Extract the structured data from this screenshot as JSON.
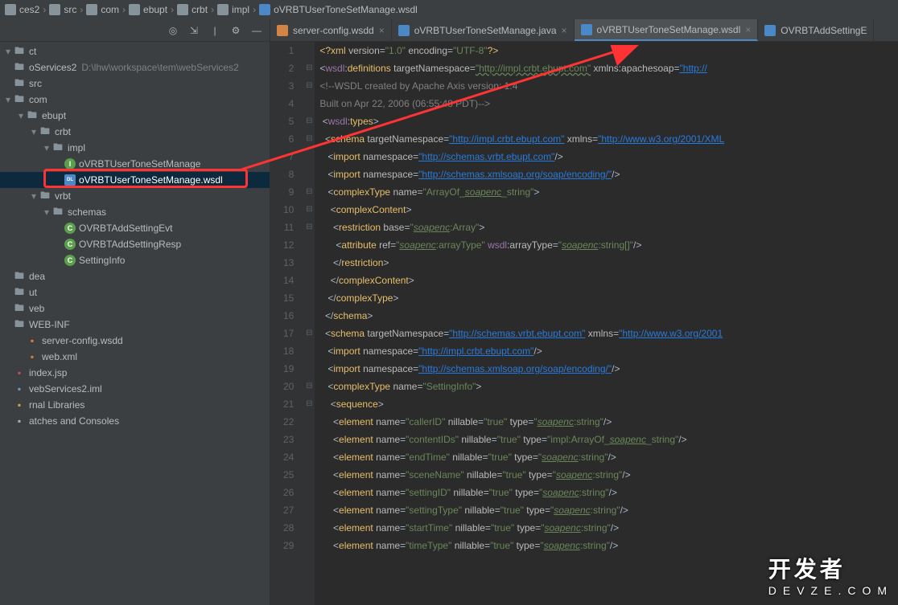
{
  "breadcrumb": [
    "ces2",
    "src",
    "com",
    "ebupt",
    "crbt",
    "impl",
    "oVRBTUserToneSetManage.wsdl"
  ],
  "project": {
    "name": "webServices2",
    "path": "D:\\lhw\\workspace\\tem\\webServices2"
  },
  "tree": [
    {
      "indent": 0,
      "arrow": "▾",
      "icon": "folder",
      "label": "ct"
    },
    {
      "indent": 0,
      "arrow": "",
      "icon": "folder",
      "label": "oServices2",
      "path": "D:\\lhw\\workspace\\tem\\webServices2"
    },
    {
      "indent": 0,
      "arrow": "",
      "icon": "folder",
      "label": "src"
    },
    {
      "indent": 0,
      "arrow": "▾",
      "icon": "folder",
      "label": "com"
    },
    {
      "indent": 1,
      "arrow": "▾",
      "icon": "folder",
      "label": "ebupt"
    },
    {
      "indent": 2,
      "arrow": "▾",
      "icon": "folder",
      "label": "crbt"
    },
    {
      "indent": 3,
      "arrow": "▾",
      "icon": "folder",
      "label": "impl"
    },
    {
      "indent": 4,
      "arrow": "",
      "icon": "interface-i",
      "iconText": "I",
      "label": "oVRBTUserToneSetManage"
    },
    {
      "indent": 4,
      "arrow": "",
      "icon": "wsdl",
      "iconText": "DL",
      "label": "oVRBTUserToneSetManage.wsdl",
      "selected": true,
      "boxed": true
    },
    {
      "indent": 2,
      "arrow": "▾",
      "icon": "folder",
      "label": "vrbt"
    },
    {
      "indent": 3,
      "arrow": "▾",
      "icon": "folder",
      "label": "schemas"
    },
    {
      "indent": 4,
      "arrow": "",
      "icon": "class-c",
      "iconText": "C",
      "label": "OVRBTAddSettingEvt"
    },
    {
      "indent": 4,
      "arrow": "",
      "icon": "class-c",
      "iconText": "C",
      "label": "OVRBTAddSettingResp"
    },
    {
      "indent": 4,
      "arrow": "",
      "icon": "class-c",
      "iconText": "C",
      "label": "SettingInfo"
    },
    {
      "indent": 0,
      "arrow": "",
      "icon": "folder",
      "label": "dea"
    },
    {
      "indent": 0,
      "arrow": "",
      "icon": "folder",
      "label": "ut"
    },
    {
      "indent": 0,
      "arrow": "",
      "icon": "folder",
      "label": "veb"
    },
    {
      "indent": 0,
      "arrow": "",
      "icon": "folder",
      "label": "WEB-INF"
    },
    {
      "indent": 1,
      "arrow": "",
      "icon": "xml",
      "label": "server-config.wsdd"
    },
    {
      "indent": 1,
      "arrow": "",
      "icon": "xml",
      "label": "web.xml"
    },
    {
      "indent": 0,
      "arrow": "",
      "icon": "jsp",
      "label": "index.jsp"
    },
    {
      "indent": 0,
      "arrow": "",
      "icon": "iml",
      "label": "vebServices2.iml"
    },
    {
      "indent": 0,
      "arrow": "",
      "icon": "lib",
      "label": "rnal Libraries"
    },
    {
      "indent": 0,
      "arrow": "",
      "icon": "file",
      "label": "atches and Consoles"
    }
  ],
  "tabs": [
    {
      "icon": "wsdd",
      "label": "server-config.wsdd",
      "close": true
    },
    {
      "icon": "java",
      "label": "oVRBTUserToneSetManage.java",
      "close": true
    },
    {
      "icon": "wsdl",
      "label": "oVRBTUserToneSetManage.wsdl",
      "close": true,
      "active": true
    },
    {
      "icon": "java",
      "label": "OVRBTAddSettingE"
    }
  ],
  "code": {
    "start": 1,
    "lines": [
      {
        "html": "<span class='pi'>&lt;?</span><span class='tag'>xml</span> <span class='attr'>version</span>=<span class='str'>\"1.0\"</span> <span class='attr'>encoding</span>=<span class='str'>\"UTF-8\"</span><span class='pi'>?&gt;</span>"
      },
      {
        "html": "<span class='punct'>&lt;</span><span class='ns'>wsdl</span>:<span class='tag'>definitions</span> <span class='attr'>targetNamespace</span>=<span class='str-u'>\"http://impl.crbt.ebupt.com\"</span> <span class='attr'>xmlns:apachesoap</span>=<span class='link'>\"http://</span>"
      },
      {
        "html": "<span class='cmt'>&lt;!--WSDL created by Apache Axis version: 1.4</span>"
      },
      {
        "html": "<span class='cmt'>Built on Apr 22, 2006 (06:55:48 PDT)--&gt;</span>"
      },
      {
        "html": " <span class='punct'>&lt;</span><span class='ns'>wsdl</span>:<span class='tag'>types</span><span class='punct'>&gt;</span>"
      },
      {
        "html": "  <span class='punct'>&lt;</span><span class='tag'>schema</span> <span class='attr'>targetNamespace</span>=<span class='link'>\"http://impl.crbt.ebupt.com\"</span> <span class='attr'>xmlns</span>=<span class='link'>\"http://www.w3.org/2001/XML</span>"
      },
      {
        "html": "   <span class='punct'>&lt;</span><span class='tag'>import</span> <span class='attr'>namespace</span>=<span class='link'>\"http://schemas.vrbt.ebupt.com\"</span><span class='punct'>/&gt;</span>"
      },
      {
        "html": "   <span class='punct'>&lt;</span><span class='tag'>import</span> <span class='attr'>namespace</span>=<span class='link'>\"http://schemas.xmlsoap.org/soap/encoding/\"</span><span class='punct'>/&gt;</span>"
      },
      {
        "html": "   <span class='punct'>&lt;</span><span class='tag'>complexType</span> <span class='attr'>name</span>=<span class='str'>\"ArrayOf_<span class='ul'>soapenc</span>_string\"</span><span class='punct'>&gt;</span>"
      },
      {
        "html": "    <span class='punct'>&lt;</span><span class='tag'>complexContent</span><span class='punct'>&gt;</span>"
      },
      {
        "html": "     <span class='punct'>&lt;</span><span class='tag'>restriction</span> <span class='attr'>base</span>=<span class='str'>\"<span class='ul'>soapenc</span>:Array\"</span><span class='punct'>&gt;</span>"
      },
      {
        "html": "      <span class='punct'>&lt;</span><span class='tag'>attribute</span> <span class='attr'>ref</span>=<span class='str'>\"<span class='ul'>soapenc</span>:arrayType\"</span> <span class='ns'>wsdl</span>:<span class='attr'>arrayType</span>=<span class='str'>\"<span class='ul'>soapenc</span>:string[]\"</span><span class='punct'>/&gt;</span>"
      },
      {
        "html": "     <span class='punct'>&lt;/</span><span class='tag'>restriction</span><span class='punct'>&gt;</span>"
      },
      {
        "html": "    <span class='punct'>&lt;/</span><span class='tag'>complexContent</span><span class='punct'>&gt;</span>"
      },
      {
        "html": "   <span class='punct'>&lt;/</span><span class='tag'>complexType</span><span class='punct'>&gt;</span>"
      },
      {
        "html": "  <span class='punct'>&lt;/</span><span class='tag'>schema</span><span class='punct'>&gt;</span>"
      },
      {
        "html": "  <span class='punct'>&lt;</span><span class='tag'>schema</span> <span class='attr'>targetNamespace</span>=<span class='link'>\"http://schemas.vrbt.ebupt.com\"</span> <span class='attr'>xmlns</span>=<span class='link'>\"http://www.w3.org/2001</span>"
      },
      {
        "html": "   <span class='punct'>&lt;</span><span class='tag'>import</span> <span class='attr'>namespace</span>=<span class='link'>\"http://impl.crbt.ebupt.com\"</span><span class='punct'>/&gt;</span>"
      },
      {
        "html": "   <span class='punct'>&lt;</span><span class='tag'>import</span> <span class='attr'>namespace</span>=<span class='link'>\"http://schemas.xmlsoap.org/soap/encoding/\"</span><span class='punct'>/&gt;</span>"
      },
      {
        "html": "   <span class='punct'>&lt;</span><span class='tag'>complexType</span> <span class='attr'>name</span>=<span class='str'>\"SettingInfo\"</span><span class='punct'>&gt;</span>"
      },
      {
        "html": "    <span class='punct'>&lt;</span><span class='tag'>sequence</span><span class='punct'>&gt;</span>"
      },
      {
        "html": "     <span class='punct'>&lt;</span><span class='tag'>element</span> <span class='attr'>name</span>=<span class='str'>\"callerID\"</span> <span class='attr'>nillable</span>=<span class='str'>\"true\"</span> <span class='attr'>type</span>=<span class='str'>\"<span class='ul'>soapenc</span>:string\"</span><span class='punct'>/&gt;</span>"
      },
      {
        "html": "     <span class='punct'>&lt;</span><span class='tag'>element</span> <span class='attr'>name</span>=<span class='str'>\"contentIDs\"</span> <span class='attr'>nillable</span>=<span class='str'>\"true\"</span> <span class='attr'>type</span>=<span class='str'>\"impl:ArrayOf_<span class='ul'>soapenc</span>_string\"</span><span class='punct'>/&gt;</span>"
      },
      {
        "html": "     <span class='punct'>&lt;</span><span class='tag'>element</span> <span class='attr'>name</span>=<span class='str'>\"endTime\"</span> <span class='attr'>nillable</span>=<span class='str'>\"true\"</span> <span class='attr'>type</span>=<span class='str'>\"<span class='ul'>soapenc</span>:string\"</span><span class='punct'>/&gt;</span>"
      },
      {
        "html": "     <span class='punct'>&lt;</span><span class='tag'>element</span> <span class='attr'>name</span>=<span class='str'>\"sceneName\"</span> <span class='attr'>nillable</span>=<span class='str'>\"true\"</span> <span class='attr'>type</span>=<span class='str'>\"<span class='ul'>soapenc</span>:string\"</span><span class='punct'>/&gt;</span>"
      },
      {
        "html": "     <span class='punct'>&lt;</span><span class='tag'>element</span> <span class='attr'>name</span>=<span class='str'>\"settingID\"</span> <span class='attr'>nillable</span>=<span class='str'>\"true\"</span> <span class='attr'>type</span>=<span class='str'>\"<span class='ul'>soapenc</span>:string\"</span><span class='punct'>/&gt;</span>"
      },
      {
        "html": "     <span class='punct'>&lt;</span><span class='tag'>element</span> <span class='attr'>name</span>=<span class='str'>\"settingType\"</span> <span class='attr'>nillable</span>=<span class='str'>\"true\"</span> <span class='attr'>type</span>=<span class='str'>\"<span class='ul'>soapenc</span>:string\"</span><span class='punct'>/&gt;</span>"
      },
      {
        "html": "     <span class='punct'>&lt;</span><span class='tag'>element</span> <span class='attr'>name</span>=<span class='str'>\"startTime\"</span> <span class='attr'>nillable</span>=<span class='str'>\"true\"</span> <span class='attr'>type</span>=<span class='str'>\"<span class='ul'>soapenc</span>:string\"</span><span class='punct'>/&gt;</span>"
      },
      {
        "html": "     <span class='punct'>&lt;</span><span class='tag'>element</span> <span class='attr'>name</span>=<span class='str'>\"timeType\"</span> <span class='attr'>nillable</span>=<span class='str'>\"true\"</span> <span class='attr'>type</span>=<span class='str'>\"<span class='ul'>soapenc</span>:string\"</span><span class='punct'>/&gt;</span>"
      }
    ]
  },
  "watermark": {
    "big": "开发者",
    "small": "DEVZE.COM"
  }
}
